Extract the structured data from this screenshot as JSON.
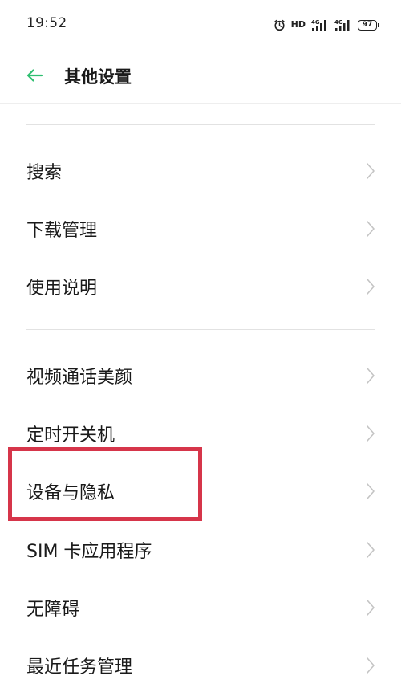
{
  "status_bar": {
    "time": "19:52",
    "hd_label": "HD",
    "battery_level": "97",
    "icons": [
      "alarm-icon",
      "hd-icon",
      "signal-4g-icon",
      "signal-4g-icon",
      "battery-icon"
    ]
  },
  "header": {
    "title": "其他设置",
    "back_icon": "arrow-left-icon"
  },
  "colors": {
    "accent": "#2fbf71",
    "highlight": "#d6354a",
    "chevron": "#c4c4c4",
    "divider": "#e2e2e2"
  },
  "menu": {
    "group1": [
      {
        "label": "搜索"
      },
      {
        "label": "下载管理"
      },
      {
        "label": "使用说明"
      }
    ],
    "group2": [
      {
        "label": "视频通话美颜"
      },
      {
        "label": "定时开关机"
      },
      {
        "label": "设备与隐私"
      },
      {
        "label": "SIM 卡应用程序"
      },
      {
        "label": "无障碍"
      },
      {
        "label": "最近任务管理"
      }
    ]
  }
}
